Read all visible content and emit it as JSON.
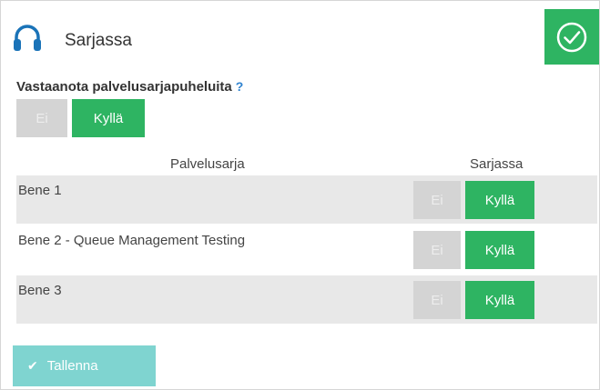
{
  "header": {
    "title": "Sarjassa",
    "icon": "headset-icon",
    "confirm_icon": "check-circle-icon",
    "accent_color": "#2eb462"
  },
  "receive_calls": {
    "question": "Vastaanota palvelusarjapuheluita",
    "help": "?",
    "no_label": "Ei",
    "yes_label": "Kyllä",
    "selected": "Kyllä"
  },
  "table": {
    "columns": [
      "Palvelusarja",
      "Sarjassa"
    ],
    "rows": [
      {
        "name": "Bene 1",
        "no_label": "Ei",
        "yes_label": "Kyllä",
        "selected": "Kyllä"
      },
      {
        "name": "Bene 2 - Queue Management Testing",
        "no_label": "Ei",
        "yes_label": "Kyllä",
        "selected": "Kyllä"
      },
      {
        "name": "Bene 3",
        "no_label": "Ei",
        "yes_label": "Kyllä",
        "selected": "Kyllä"
      }
    ]
  },
  "footer": {
    "save_label": "Tallenna",
    "save_icon": "checkmark-icon"
  }
}
